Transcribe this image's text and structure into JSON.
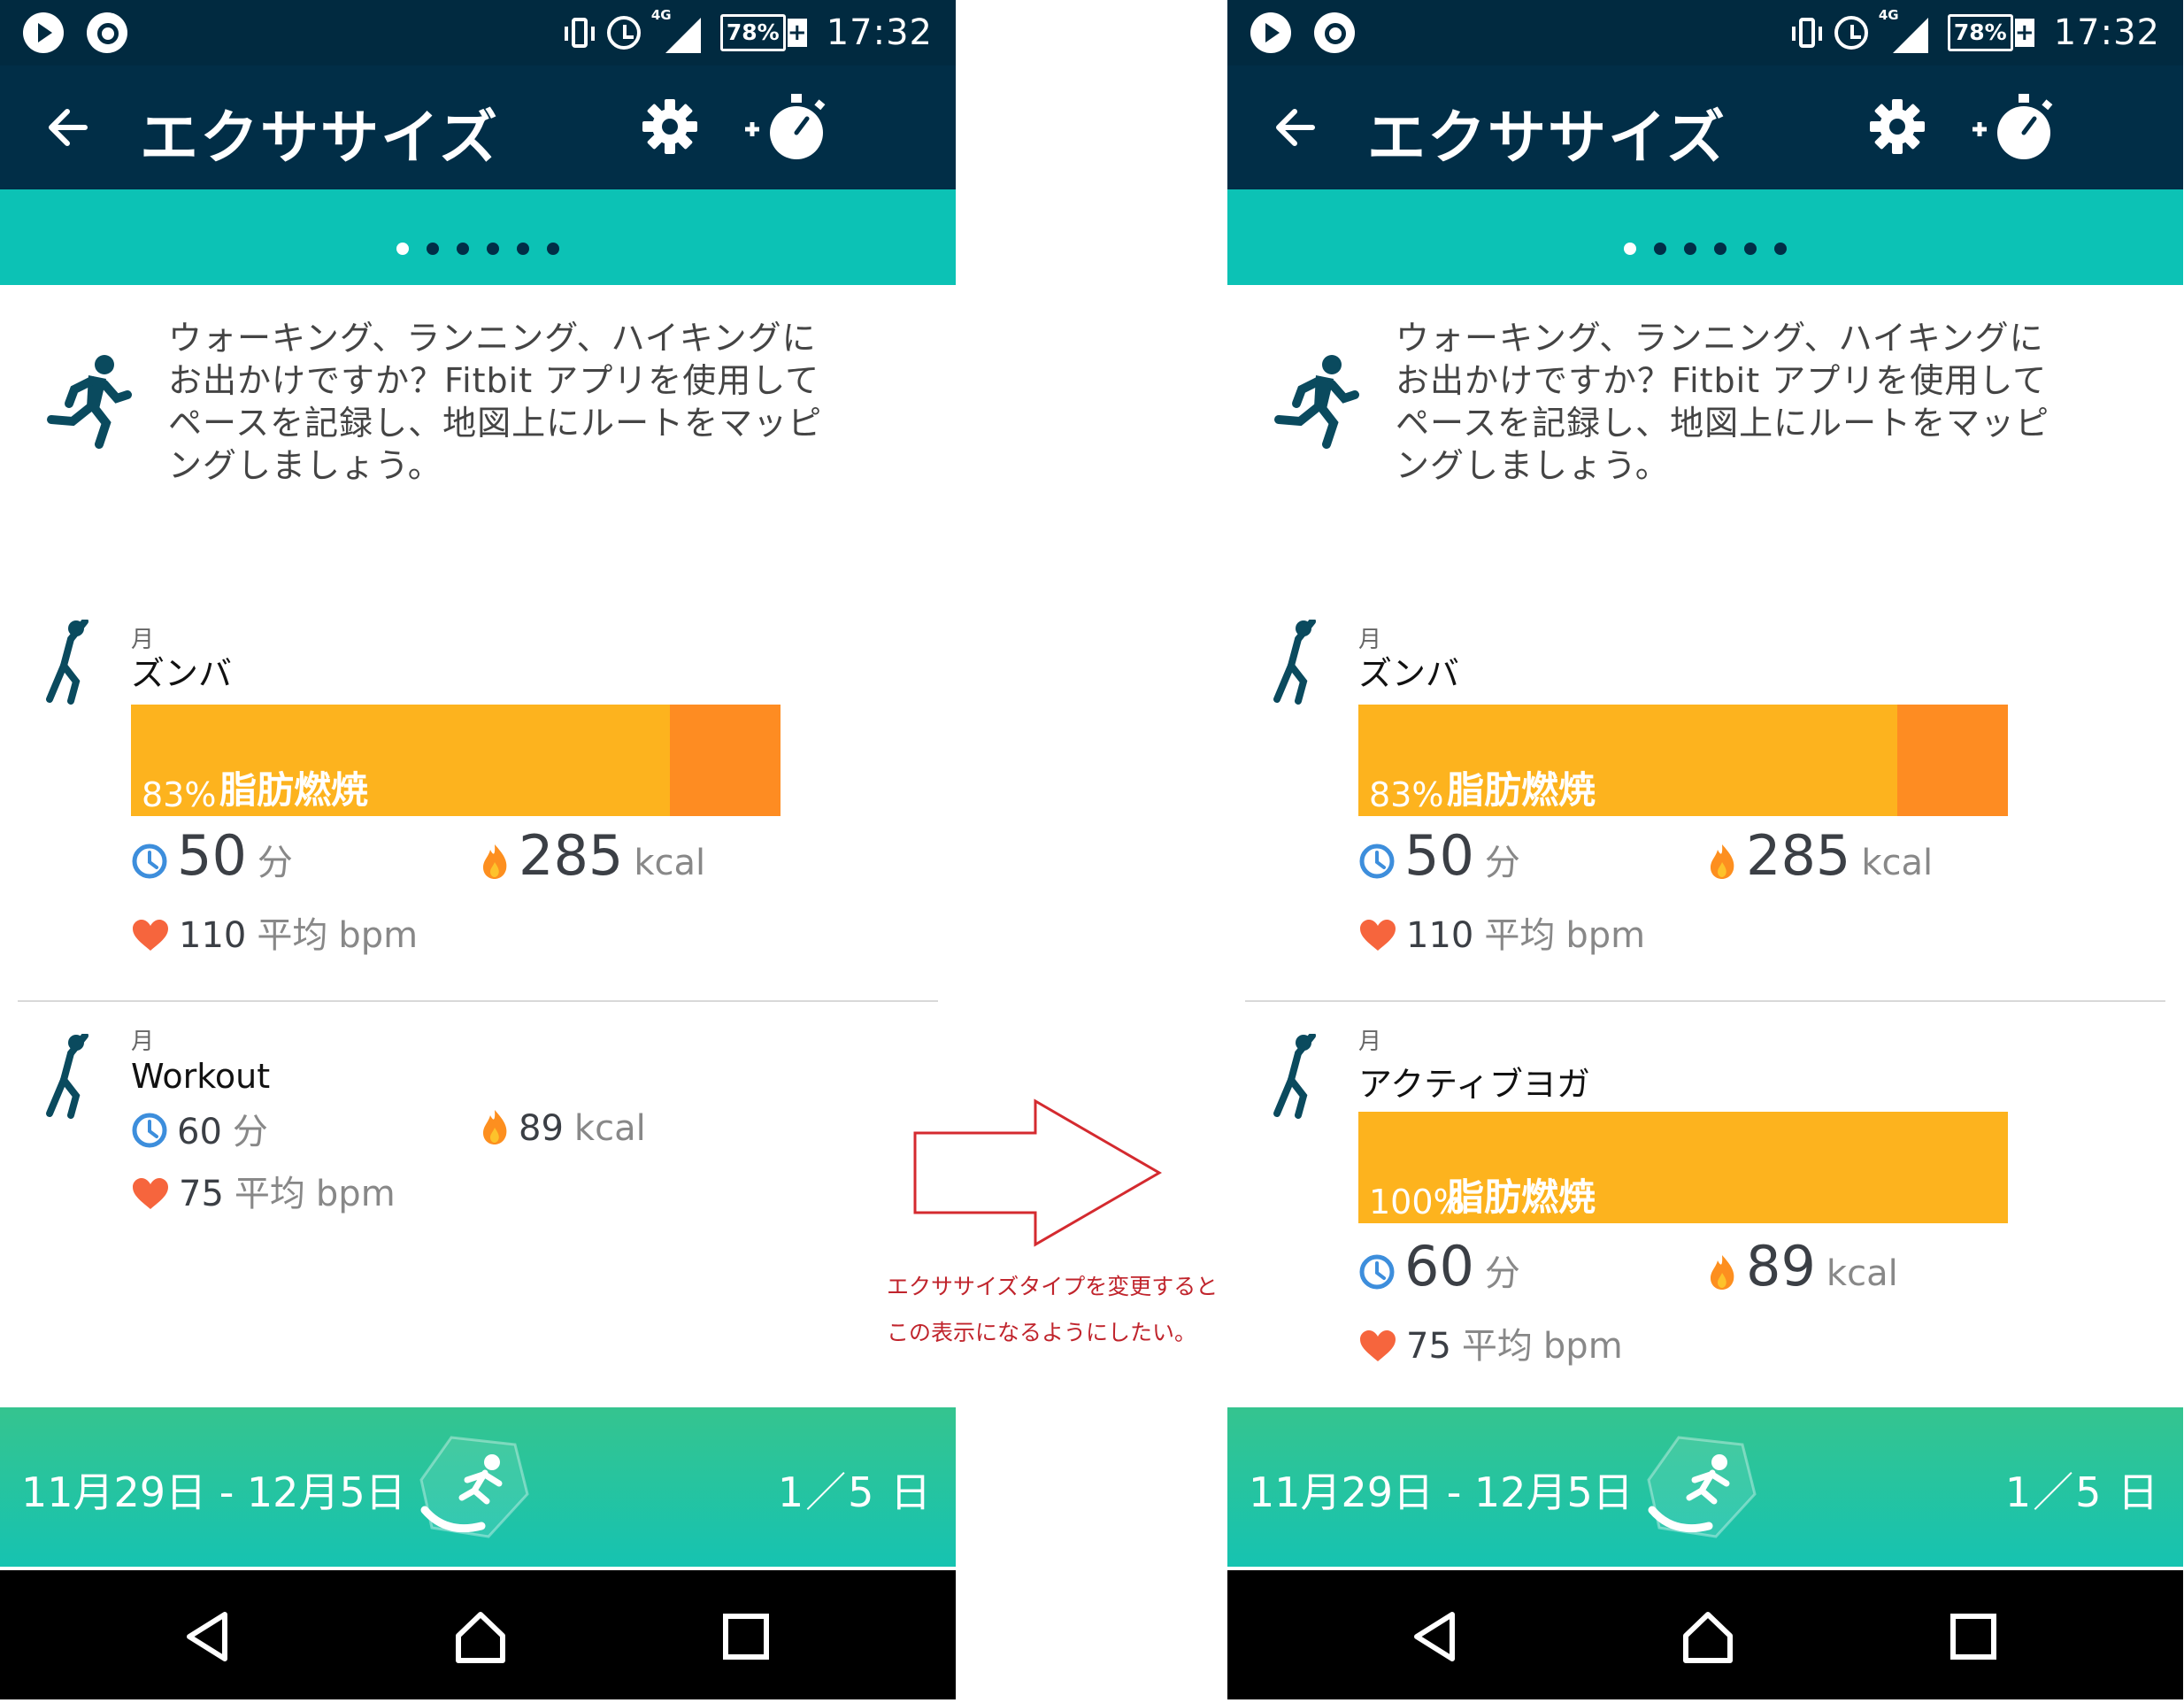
{
  "status_bar": {
    "battery": "78%",
    "network": "4G",
    "time": "17:32"
  },
  "app_bar": {
    "title": "エクササイズ"
  },
  "promo": {
    "text": "ウォーキング、ランニング、ハイキングにお出かけですか？Fitbit アプリを使用してペースを記録し、地図上にルートをマッピングしましょう。"
  },
  "left": {
    "card1": {
      "day": "月",
      "name": "ズンバ",
      "zone_percent": "83%",
      "zone_fraction": 0.83,
      "zone_label": "脂肪燃焼",
      "duration_value": "50",
      "duration_unit": "分",
      "calories_value": "285",
      "calories_unit": "kcal",
      "hr_value": "110",
      "hr_avg_label": "平均",
      "hr_unit": "bpm"
    },
    "card2": {
      "day": "月",
      "name": "Workout",
      "duration_value": "60",
      "duration_unit": "分",
      "calories_value": "89",
      "calories_unit": "kcal",
      "hr_value": "75",
      "hr_avg_label": "平均",
      "hr_unit": "bpm"
    }
  },
  "right": {
    "card1": {
      "day": "月",
      "name": "ズンバ",
      "zone_percent": "83%",
      "zone_fraction": 0.83,
      "zone_label": "脂肪燃焼",
      "duration_value": "50",
      "duration_unit": "分",
      "calories_value": "285",
      "calories_unit": "kcal",
      "hr_value": "110",
      "hr_avg_label": "平均",
      "hr_unit": "bpm"
    },
    "card2": {
      "day": "月",
      "name": "アクティブヨガ",
      "zone_percent": "100%",
      "zone_fraction": 1.0,
      "zone_label": "脂肪燃焼",
      "duration_value": "60",
      "duration_unit": "分",
      "calories_value": "89",
      "calories_unit": "kcal",
      "hr_value": "75",
      "hr_avg_label": "平均",
      "hr_unit": "bpm"
    }
  },
  "footer": {
    "date_range": "11月29日 - 12月5日",
    "day_count": "1／5 日"
  },
  "annotation": {
    "line1": "エクササイズタイプを変更すると",
    "line2": "この表示になるようにしたい。"
  },
  "colors": {
    "header": "#012e47",
    "teal": "#0cc2b5",
    "zone_fat_burn": "#fdb31e",
    "zone_peak": "#fe8c22",
    "annotation": "#c0242c"
  }
}
